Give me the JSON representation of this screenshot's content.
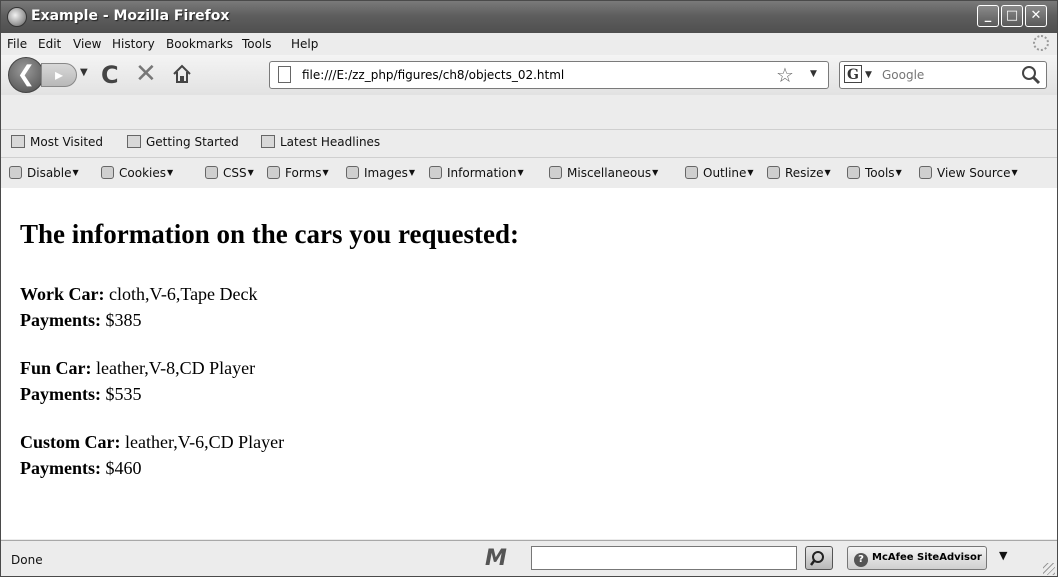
{
  "window": {
    "title": "Example - Mozilla Firefox",
    "controls": {
      "minimize": "_",
      "maximize": "□",
      "close": "✕"
    }
  },
  "menu": {
    "items": [
      "File",
      "Edit",
      "View",
      "History",
      "Bookmarks",
      "Tools",
      "Help"
    ]
  },
  "nav": {
    "back_glyph": "❮",
    "forward_glyph": "▸",
    "reload_glyph": "C",
    "stop_glyph": "✕",
    "url": "file:///E:/zz_php/figures/ch8/objects_02.html",
    "search_placeholder": "Google",
    "search_engine_glyph": "G"
  },
  "bookmarks": {
    "items": [
      "Most Visited",
      "Getting Started",
      "Latest Headlines"
    ]
  },
  "devtoolbar": {
    "items": [
      "Disable",
      "Cookies",
      "CSS",
      "Forms",
      "Images",
      "Information",
      "Miscellaneous",
      "Outline",
      "Resize",
      "Tools",
      "View Source"
    ]
  },
  "page": {
    "heading": "The information on the cars you requested:",
    "cars": [
      {
        "label": "Work Car:",
        "features": "cloth,V-6,Tape Deck",
        "payments_label": "Payments:",
        "payments": "$385"
      },
      {
        "label": "Fun Car:",
        "features": "leather,V-8,CD Player",
        "payments_label": "Payments:",
        "payments": "$535"
      },
      {
        "label": "Custom Car:",
        "features": "leather,V-6,CD Player",
        "payments_label": "Payments:",
        "payments": "$460"
      }
    ]
  },
  "status": {
    "text": "Done",
    "logo": "M",
    "siteadvisor_label": "McAfee SiteAdvisor",
    "siteadvisor_glyph": "?"
  },
  "colors": {
    "titlebar": "#5e5e5e",
    "chrome": "#ececec",
    "content_bg": "#ffffff"
  }
}
